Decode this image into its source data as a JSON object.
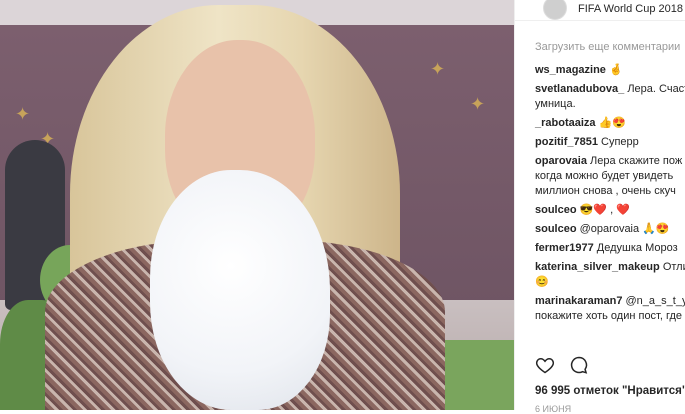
{
  "post": {
    "location": "FIFA World Cup 2018"
  },
  "comments": {
    "load_more": "Загрузить еще комментарии",
    "items": [
      {
        "user": "ws_magazine",
        "text": "🤞"
      },
      {
        "user": "svetlanadubova_",
        "text": "Лера. Счастья,",
        "text2": "умница."
      },
      {
        "user": "_rabotaaiza",
        "text": "👍😍"
      },
      {
        "user": "pozitif_7851",
        "text": "Суперр"
      },
      {
        "user": "oparovaia",
        "text": "Лера скажите пож",
        "text2": "когда можно будет увидеть",
        "text3": "миллион снова , очень скуч"
      },
      {
        "user": "soulceo",
        "text": "😎❤️ , ❤️"
      },
      {
        "user": "soulceo",
        "text": "@oparovaia 🙏😍"
      },
      {
        "user": "fermer1977",
        "text": "Дедушка Мороз"
      },
      {
        "user": "katerina_silver_makeup",
        "text": "Отли",
        "text2": "😊"
      },
      {
        "user": "marinakaraman7",
        "text": "@n_a_s_t_y",
        "text2": "покажите хоть один пост, где"
      }
    ]
  },
  "likes": {
    "text": "96 995 отметок \"Нравится\""
  },
  "date": "6 ИЮНЯ",
  "colors": {
    "text": "#262626",
    "muted": "#999999",
    "link": "#003569"
  }
}
